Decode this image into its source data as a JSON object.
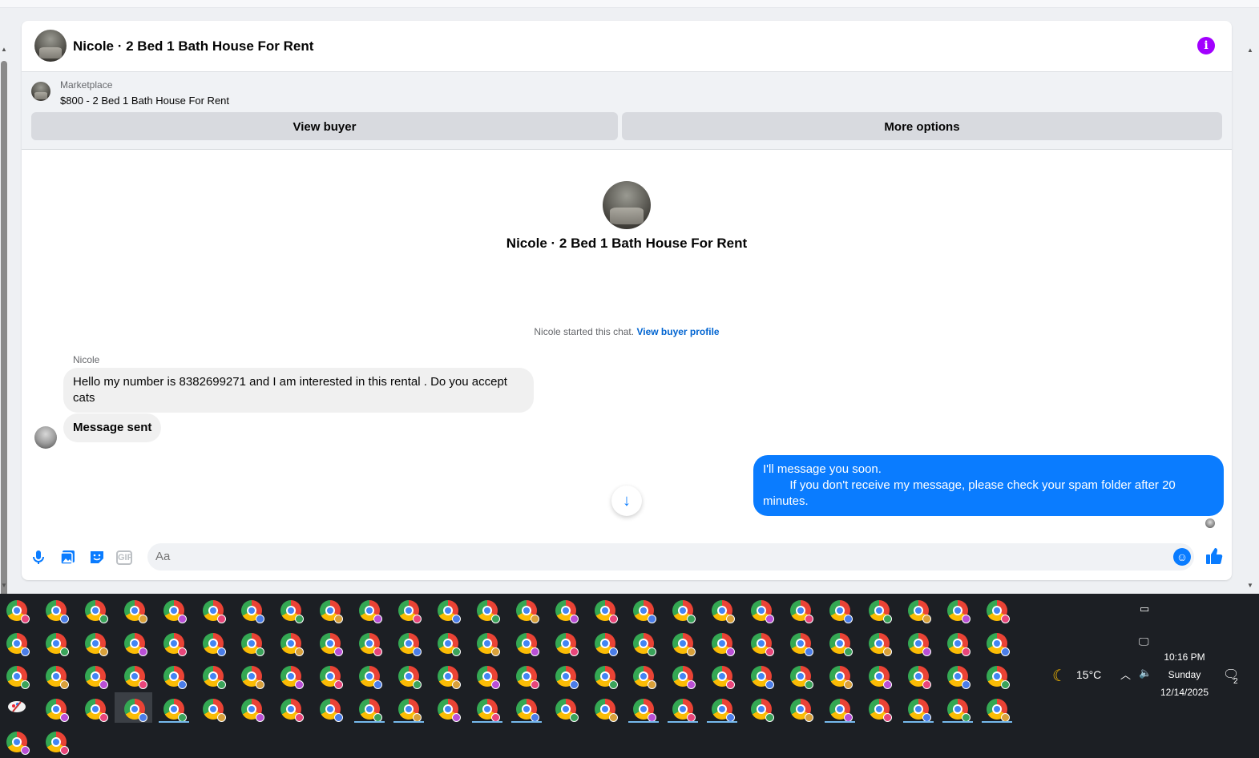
{
  "header": {
    "title": "Nicole · 2 Bed 1 Bath House For Rent",
    "info_icon": "info-icon"
  },
  "marketplace": {
    "label": "Marketplace",
    "listing": "$800 - 2 Bed 1 Bath House For Rent",
    "view_buyer_label": "View buyer",
    "more_options_label": "More options"
  },
  "conversation": {
    "title": "Nicole · 2 Bed 1 Bath House For Rent",
    "started_text": "Nicole started this chat.",
    "view_profile_link": "View buyer profile",
    "sender_name": "Nicole",
    "messages": [
      {
        "direction": "incoming",
        "text": "Hello my number is 8382699271 and I am interested in this rental . Do you accept cats"
      },
      {
        "direction": "incoming",
        "text": "Message sent"
      },
      {
        "direction": "outgoing",
        "text": "I'll message you soon.\n        If you don't receive my message, please check your spam folder after 20 minutes."
      }
    ]
  },
  "composer": {
    "placeholder": "Aa",
    "gif_label": "GIF",
    "icons": [
      "microphone-icon",
      "photo-icon",
      "sticker-icon",
      "gif-icon",
      "emoji-icon",
      "thumbs-up-icon"
    ]
  },
  "tray": {
    "temperature": "15°C",
    "time": "10:16 PM",
    "day": "Sunday",
    "date": "12/14/2025",
    "notification_count": "2"
  },
  "colors": {
    "accent": "#0a7cff",
    "info": "#a200ff",
    "taskbar": "#1c1f24"
  }
}
